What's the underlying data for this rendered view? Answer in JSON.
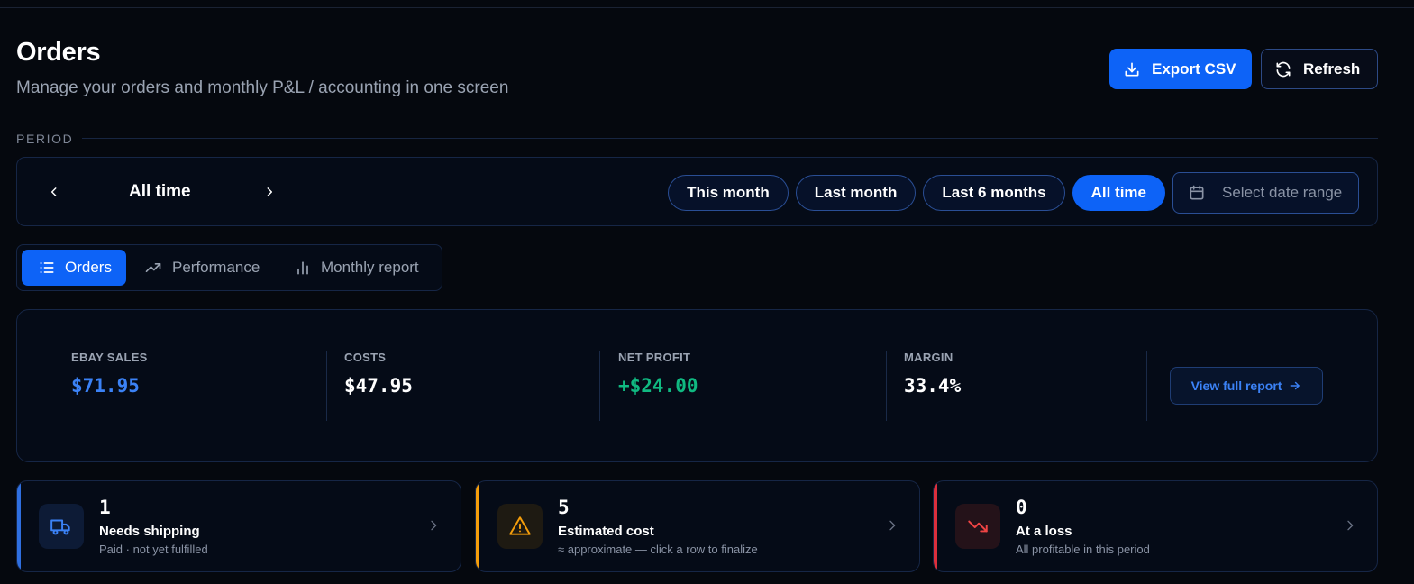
{
  "header": {
    "title": "Orders",
    "subtitle": "Manage your orders and monthly P&L / accounting in one screen",
    "export_label": "Export CSV",
    "refresh_label": "Refresh"
  },
  "period": {
    "section_label": "PERIOD",
    "current": "All time",
    "chips": [
      "This month",
      "Last month",
      "Last 6 months",
      "All time"
    ],
    "active_chip": "All time",
    "date_range_placeholder": "Select date range"
  },
  "tabs": [
    {
      "label": "Orders",
      "icon": "list-icon",
      "active": true
    },
    {
      "label": "Performance",
      "icon": "trending-up-icon",
      "active": false
    },
    {
      "label": "Monthly report",
      "icon": "bar-chart-icon",
      "active": false
    }
  ],
  "summary": {
    "stats": [
      {
        "label": "EBAY SALES",
        "value": "$71.95",
        "color": "#3b82f6"
      },
      {
        "label": "COSTS",
        "value": "$47.95",
        "color": "#ffffff"
      },
      {
        "label": "NET PROFIT",
        "value": "+$24.00",
        "color": "#10b981"
      },
      {
        "label": "MARGIN",
        "value": "33.4%",
        "color": "#ffffff"
      }
    ],
    "report_button": "View full report"
  },
  "cards": [
    {
      "count": "1",
      "title": "Needs shipping",
      "subtitle": "Paid · not yet fulfilled",
      "icon": "truck-icon",
      "accent": "#2f6fe0"
    },
    {
      "count": "5",
      "title": "Estimated cost",
      "subtitle": "≈ approximate — click a row to finalize",
      "icon": "warning-icon",
      "accent": "#f59e0b"
    },
    {
      "count": "0",
      "title": "At a loss",
      "subtitle": "All profitable in this period",
      "icon": "trending-down-icon",
      "accent": "#dc2f3c"
    }
  ]
}
